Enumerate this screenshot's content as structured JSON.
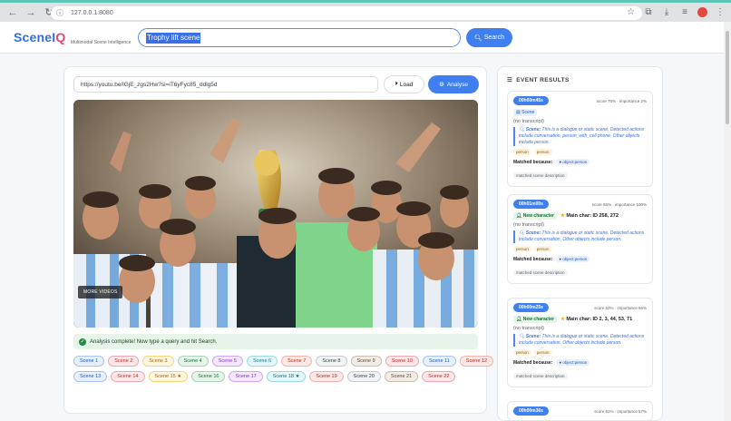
{
  "browser": {
    "url": "127.0.0.1:8080"
  },
  "app": {
    "logo_main": "SceneI",
    "logo_q": "Q",
    "tagline": "Multimodal Scene Intelligence",
    "search_query": "Trophy lift scene",
    "search_button": "Search"
  },
  "main": {
    "video_url": "https://youtu.be/lGjE_zgs2Hw?si=iT6yFyc85_ddlg5d",
    "load_label": "Load",
    "analyse_label": "Analyse",
    "more_videos": "MORE VIDEOS",
    "status": "Analysis complete! Now type a query and hit Search.",
    "scene_rows": [
      [
        "Scene 1",
        "Scene 2",
        "Scene 3",
        "Scene 4",
        "Scene 5",
        "Scene 6",
        "Scene 7",
        "Scene 8",
        "Scene 9",
        "Scene 10",
        "Scene 11",
        "Scene 12"
      ],
      [
        "Scene 13",
        "Scene 14",
        "Scene 15 ★",
        "Scene 16",
        "Scene 17",
        "Scene 18 ★",
        "Scene 19",
        "Scene 20",
        "Scene 21",
        "Scene 22"
      ]
    ]
  },
  "results": {
    "title": "EVENT RESULTS",
    "cards": [
      {
        "timestamp": "00h00m45s",
        "score": "score 75% · importance 2%",
        "badge": "Scene",
        "transcript": "(no transcript)",
        "desc_label": "Scene:",
        "desc_text": "This is a dialogue or static scene. Detected actions include conversation, person_with_cell phone. Other objects include person.",
        "objects": [
          "person",
          "person"
        ],
        "matched_label": "Matched because:",
        "matched_pill": "object:person",
        "matched_desc": "matched scene description"
      },
      {
        "timestamp": "00h01m00s",
        "score": "score 65% · importance 100%",
        "badge": "New character",
        "main_char": "Main char: ID 258, 272",
        "transcript": "(no transcript)",
        "desc_label": "Scene:",
        "desc_text": "This is a dialogue or static scene. Detected actions include conversation. Other objects include person.",
        "objects": [
          "person",
          "person"
        ],
        "matched_label": "Matched because:",
        "matched_pill": "object:person",
        "matched_desc": "matched scene description"
      },
      {
        "timestamp": "00h00m25s",
        "score": "score 62% · importance 66%",
        "badge": "New character",
        "main_char": "Main char: ID 2, 3, 44, 53, 71",
        "transcript": "(no transcript)",
        "desc_label": "Scene:",
        "desc_text": "This is a dialogue or static scene. Detected actions include conversation. Other objects include person.",
        "objects": [
          "person",
          "person"
        ],
        "matched_label": "Matched because:",
        "matched_pill": "object:person",
        "matched_desc": "matched scene description"
      },
      {
        "timestamp": "00h00m36s",
        "score": "score 61% · importance 57%"
      }
    ]
  },
  "colors": {
    "accent": "#3f7ff0",
    "logo_blue": "#2f6fe6",
    "logo_pink": "#e0457b"
  }
}
